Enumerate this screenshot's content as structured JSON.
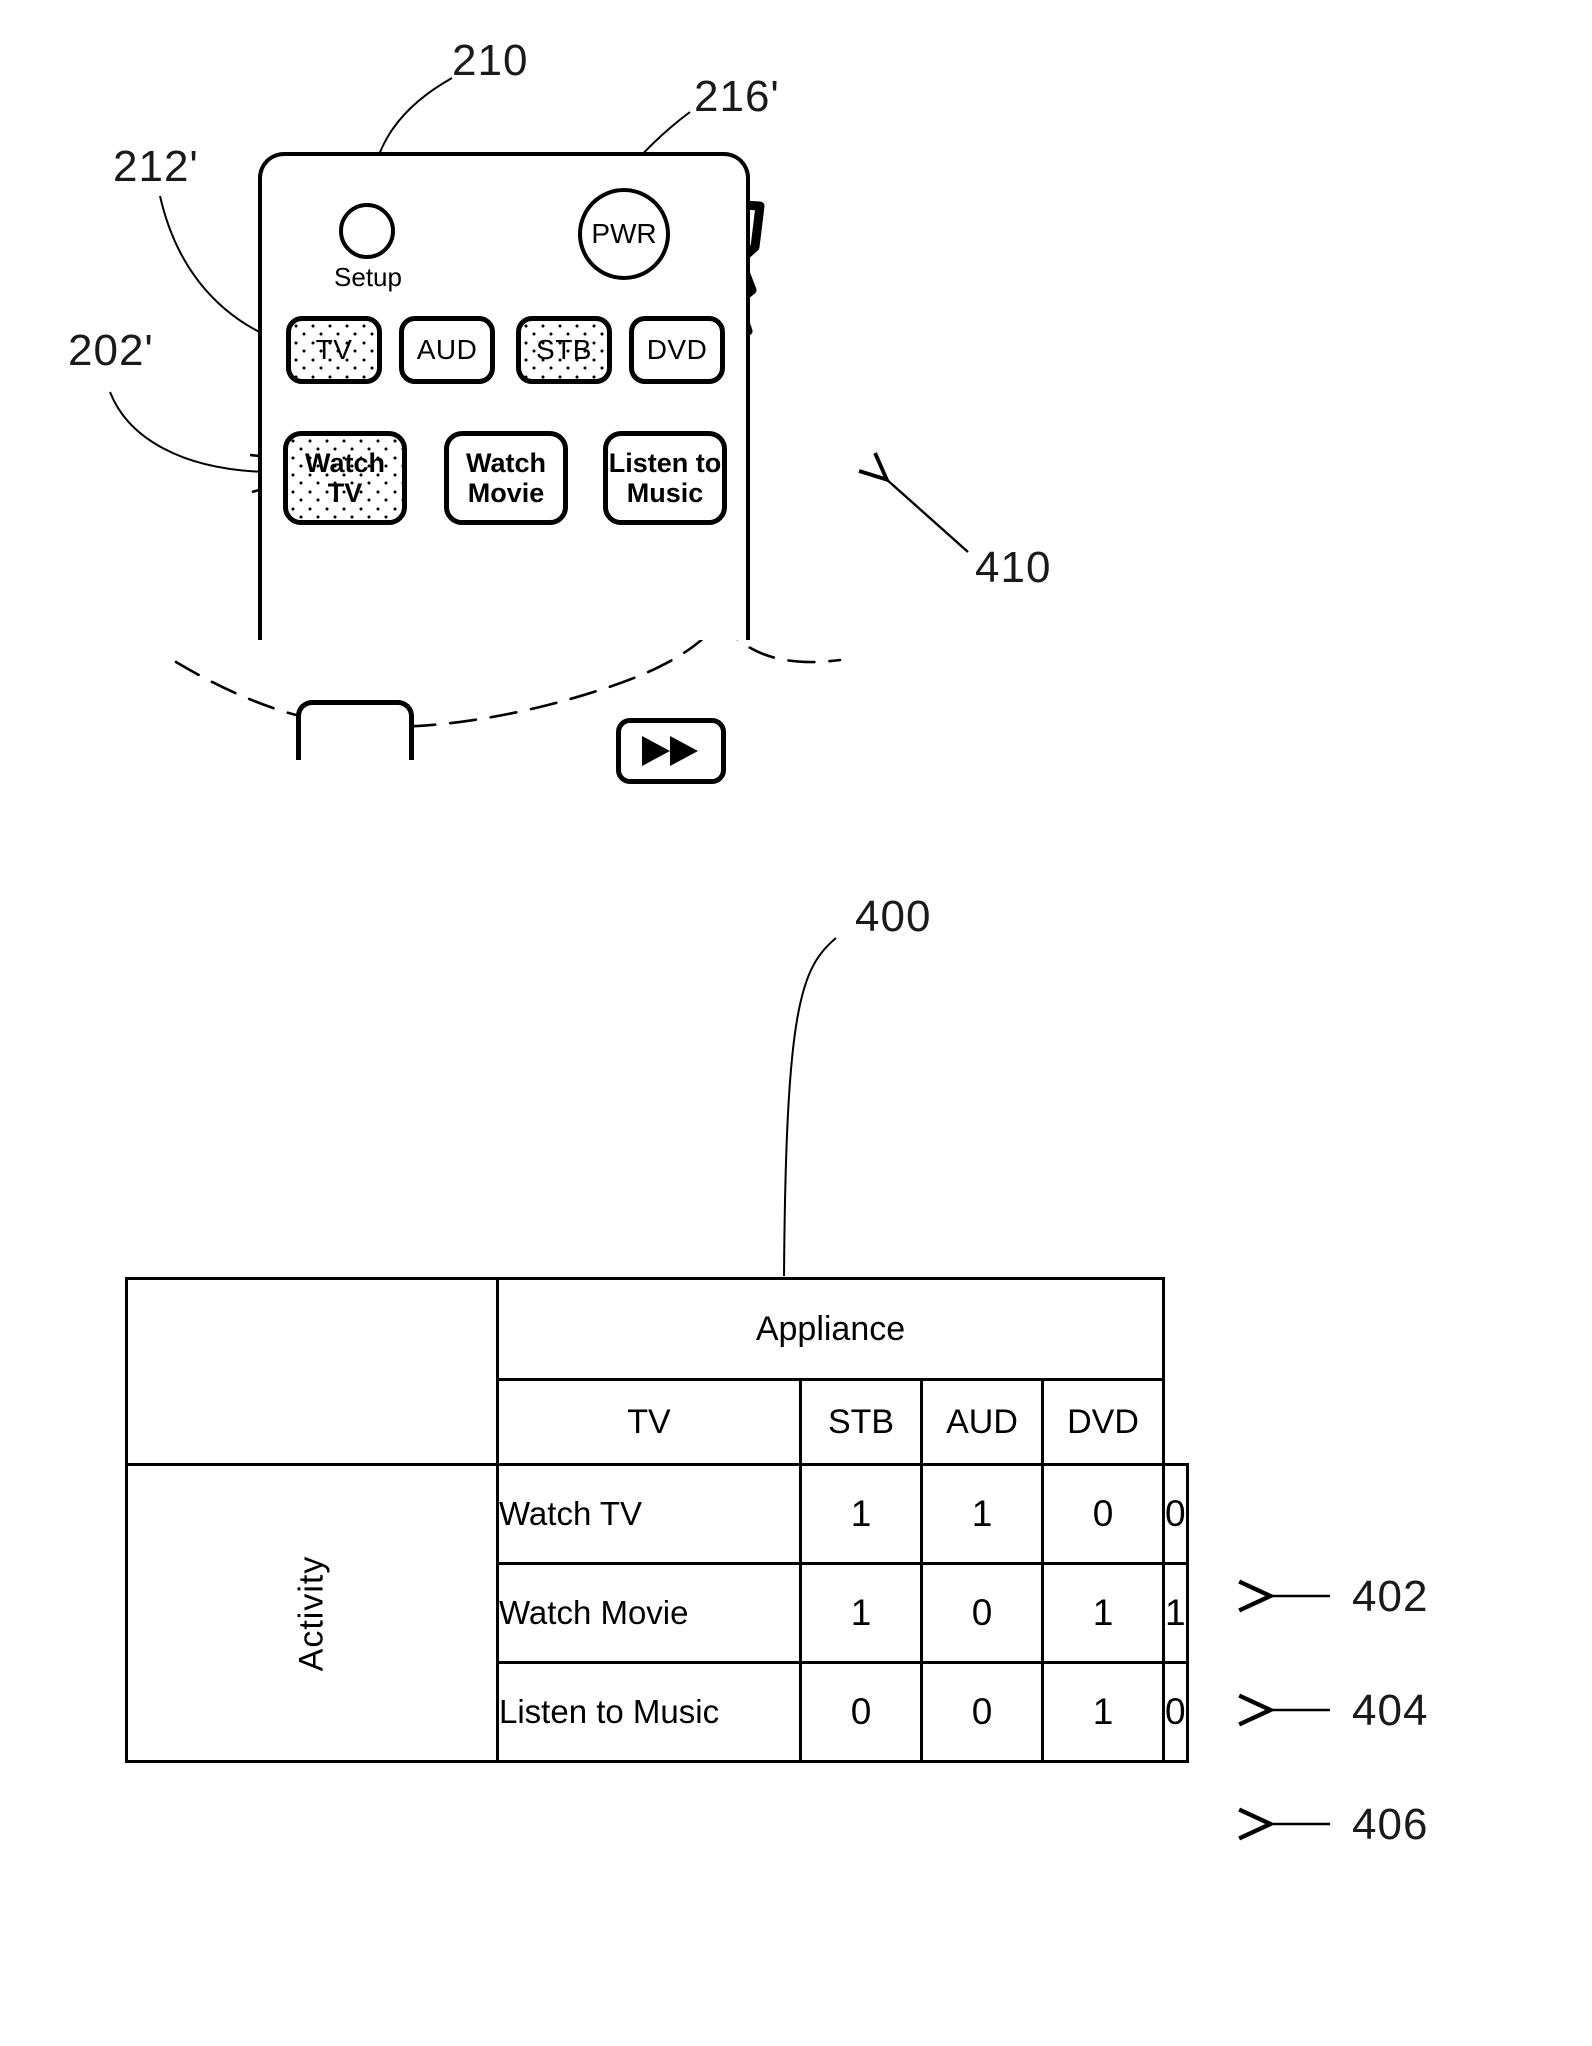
{
  "figure": {
    "remote": {
      "setup_button_label": "Setup",
      "power_button_label": "PWR",
      "device_buttons": [
        {
          "label": "TV",
          "highlighted": true
        },
        {
          "label": "AUD",
          "highlighted": false
        },
        {
          "label": "STB",
          "highlighted": true
        },
        {
          "label": "DVD",
          "highlighted": false
        }
      ],
      "activity_buttons": [
        {
          "line1": "Watch",
          "line2": "TV",
          "highlighted": true
        },
        {
          "line1": "Watch",
          "line2": "Movie",
          "highlighted": false
        },
        {
          "line1": "Listen to",
          "line2": "Music",
          "highlighted": false
        }
      ],
      "transport_button_icon": "fast-forward-icon",
      "pointer_icon": "hand-pointing-icon"
    },
    "reference_labels": {
      "remote_body": "210",
      "device_button_tv": "212'",
      "device_button_stb": "216'",
      "activity_button_watch_tv": "202'",
      "figure_410": "410",
      "table": "400",
      "row_watch_tv": "402",
      "row_watch_movie": "404",
      "row_listen_to_music": "406"
    }
  },
  "chart_data": {
    "type": "table",
    "title": "Appliance",
    "row_group_label": "Activity",
    "columns": [
      "TV",
      "STB",
      "AUD",
      "DVD"
    ],
    "rows": [
      {
        "activity": "Watch TV",
        "values": [
          1,
          1,
          0,
          0
        ],
        "ref": "402"
      },
      {
        "activity": "Watch Movie",
        "values": [
          1,
          0,
          1,
          1
        ],
        "ref": "404"
      },
      {
        "activity": "Listen to Music",
        "values": [
          0,
          0,
          1,
          0
        ],
        "ref": "406"
      }
    ],
    "corner_blank": ""
  },
  "table": {
    "appliance_header": "Appliance",
    "activity_header": "Activity",
    "col_tv": "TV",
    "col_stb": "STB",
    "col_aud": "AUD",
    "col_dvd": "DVD",
    "r0_name": "Watch TV",
    "r0_c0": "1",
    "r0_c1": "1",
    "r0_c2": "0",
    "r0_c3": "0",
    "r1_name": "Watch Movie",
    "r1_c0": "1",
    "r1_c1": "0",
    "r1_c2": "1",
    "r1_c3": "1",
    "r2_name": "Listen to Music",
    "r2_c0": "0",
    "r2_c1": "0",
    "r2_c2": "1",
    "r2_c3": "0"
  },
  "buttons": {
    "tv": "TV",
    "aud": "AUD",
    "stb": "STB",
    "dvd": "DVD",
    "setup": "Setup",
    "pwr": "PWR",
    "watch_tv_l1": "Watch",
    "watch_tv_l2": "TV",
    "watch_movie_l1": "Watch",
    "watch_movie_l2": "Movie",
    "listen_music_l1": "Listen to",
    "listen_music_l2": "Music"
  },
  "refs": {
    "n210": "210",
    "n212p": "212'",
    "n216p": "216'",
    "n202p": "202'",
    "n410": "410",
    "n400": "400",
    "n402": "402",
    "n404": "404",
    "n406": "406"
  }
}
